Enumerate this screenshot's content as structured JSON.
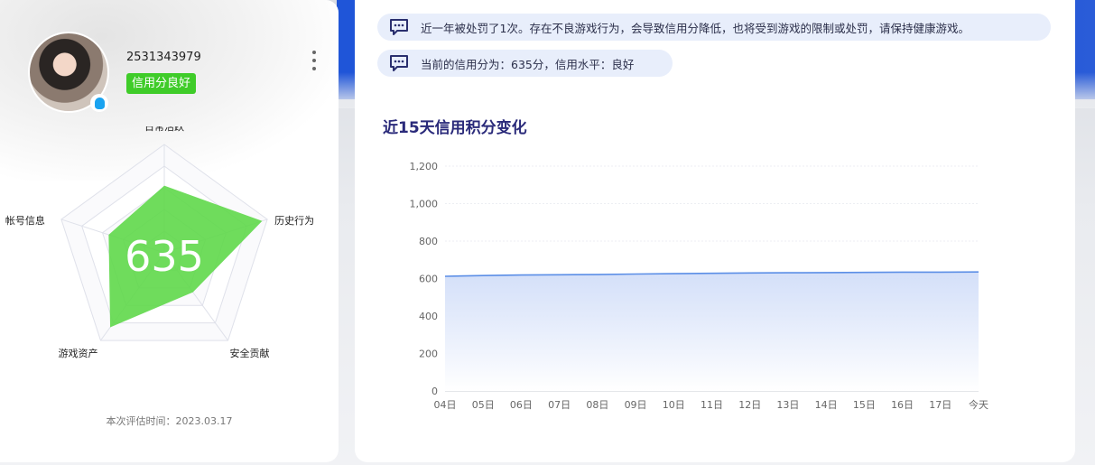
{
  "profile": {
    "user_id": "2531343979",
    "credit_badge": "信用分良好",
    "more_icon": "more-vertical-icon",
    "qq_icon": "qq-penguin-icon"
  },
  "radar": {
    "score": "635",
    "axes": [
      "日常活跃",
      "历史行为",
      "安全贡献",
      "游戏资产",
      "帐号信息"
    ],
    "values": [
      0.62,
      0.95,
      0.45,
      0.85,
      0.54
    ],
    "fill_color": "#5fd84a"
  },
  "eval_time": "本次评估时间：2023.03.17",
  "notices": [
    {
      "icon": "message-icon",
      "text": "近一年被处罚了1次。存在不良游戏行为，会导致信用分降低，也将受到游戏的限制或处罚，请保持健康游戏。"
    },
    {
      "icon": "message-icon",
      "text": "当前的信用分为：635分，信用水平：良好"
    }
  ],
  "chart_data": {
    "type": "area",
    "title": "近15天信用积分变化",
    "categories": [
      "04日",
      "05日",
      "06日",
      "07日",
      "08日",
      "09日",
      "10日",
      "11日",
      "12日",
      "13日",
      "14日",
      "15日",
      "16日",
      "17日",
      "今天"
    ],
    "values": [
      612,
      616,
      619,
      620,
      621,
      624,
      626,
      628,
      630,
      631,
      632,
      633,
      634,
      634,
      635
    ],
    "yticks": [
      "0",
      "200",
      "400",
      "600",
      "800",
      "1,000",
      "1,200"
    ],
    "ylim": [
      0,
      1200
    ],
    "line_color": "#5b8ee6",
    "grid": true
  }
}
